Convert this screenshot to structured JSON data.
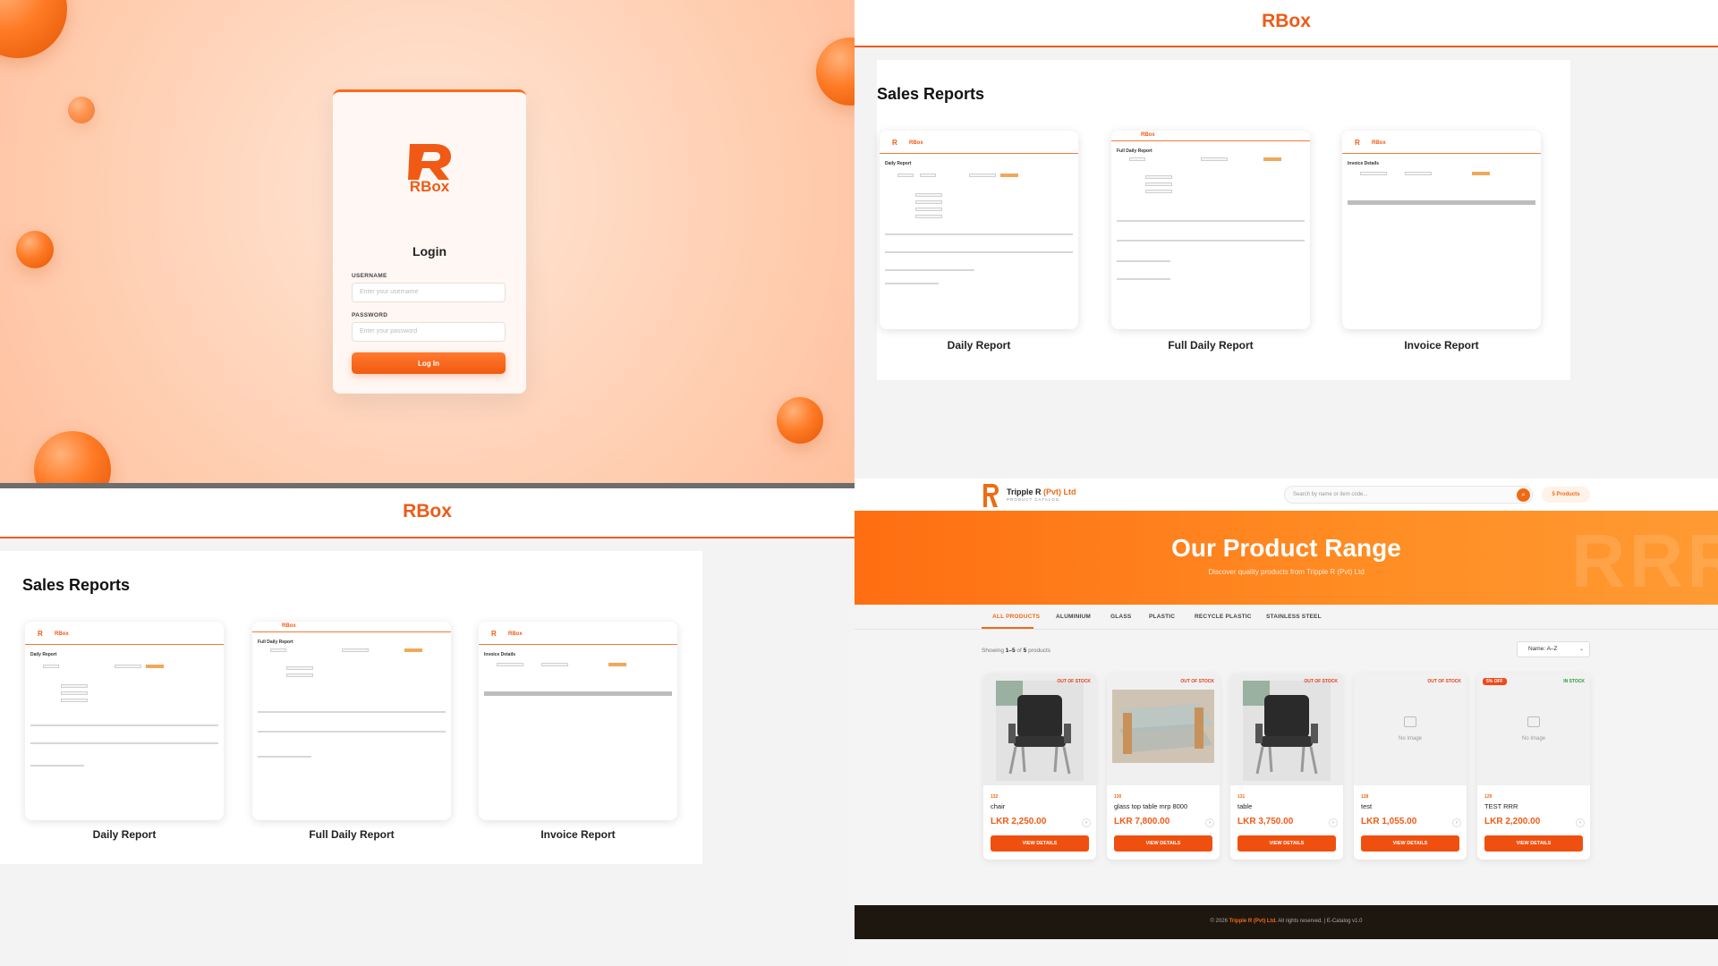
{
  "login": {
    "logo_text": "RBox",
    "title": "Login",
    "username_label": "USERNAME",
    "username_placeholder": "Enter your username",
    "password_label": "PASSWORD",
    "password_placeholder": "Enter your password",
    "submit_label": "Log In"
  },
  "reports_top": {
    "brand": "RBox",
    "title": "Sales Reports",
    "cards": [
      {
        "label": "Daily Report"
      },
      {
        "label": "Full Daily Report"
      },
      {
        "label": "Invoice Report"
      }
    ]
  },
  "reports_bottom": {
    "brand": "RBox",
    "title": "Sales Reports",
    "cards": [
      {
        "label": "Daily Report"
      },
      {
        "label": "Full Daily Report"
      },
      {
        "label": "Invoice Report"
      }
    ]
  },
  "report_thumbs": {
    "logo": "RBox",
    "daily_title": "Daily Report",
    "full_daily_title": "Full Daily Report",
    "invoice_title": "Invoice Details"
  },
  "catalog": {
    "brand_main": "Tripple R ",
    "brand_accent": "(Pvt) Ltd",
    "brand_sub": "PRODUCT CATALOG",
    "search_placeholder": "Search by name or item code...",
    "product_count": "5 Products",
    "hero_title": "Our Product Range",
    "hero_subtitle": "Discover quality products from Tripple R (Pvt) Ltd",
    "hero_watermark": "RRR",
    "tabs": [
      "ALL PRODUCTS",
      "ALUMINIUM",
      "GLASS",
      "PLASTIC",
      "RECYCLE PLASTIC",
      "STAINLESS STEEL"
    ],
    "showing_prefix": "Showing ",
    "showing_range": "1–5",
    "showing_of": " of ",
    "showing_total": "5",
    "showing_suffix": " products",
    "sort_value": "Name: A–Z",
    "products": [
      {
        "code": "132",
        "name": "chair",
        "price": "LKR 2,250.00",
        "stock": "OUT OF STOCK",
        "button": "VIEW DETAILS",
        "image": "chair"
      },
      {
        "code": "130",
        "name": "glass top table mrp 8000",
        "price": "LKR 7,800.00",
        "stock": "OUT OF STOCK",
        "button": "VIEW DETAILS",
        "image": "table"
      },
      {
        "code": "131",
        "name": "table",
        "price": "LKR 3,750.00",
        "stock": "OUT OF STOCK",
        "button": "VIEW DETAILS",
        "image": "chair"
      },
      {
        "code": "128",
        "name": "test",
        "price": "LKR 1,055.00",
        "stock": "OUT OF STOCK",
        "button": "VIEW DETAILS",
        "image": "none",
        "no_image": "No Image"
      },
      {
        "code": "129",
        "name": "TEST RRR",
        "price": "LKR 2,200.00",
        "stock": "IN STOCK",
        "discount": "5% OFF",
        "button": "VIEW DETAILS",
        "image": "none",
        "no_image": "No Image"
      }
    ],
    "footer_prefix": "© 2026 ",
    "footer_brand": "Tripple R (Pvt) Ltd.",
    "footer_suffix": " All rights reserved.  |  E-Catalog v1.0"
  },
  "colors": {
    "accent": "#f05a15",
    "stock_out": "#e0401a",
    "stock_in": "#2a9a3a",
    "footer_bg": "#1e1710"
  }
}
